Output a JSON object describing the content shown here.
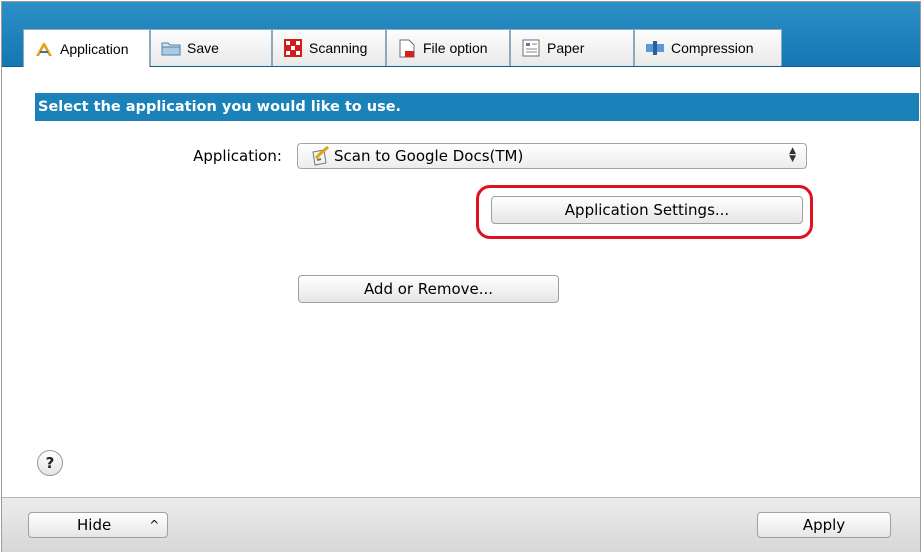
{
  "tabs": [
    {
      "label": "Application",
      "icon": "application-icon",
      "active": true
    },
    {
      "label": "Save",
      "icon": "save-icon"
    },
    {
      "label": "Scanning",
      "icon": "scanning-icon"
    },
    {
      "label": "File option",
      "icon": "file-option-icon"
    },
    {
      "label": "Paper",
      "icon": "paper-icon"
    },
    {
      "label": "Compression",
      "icon": "compression-icon"
    }
  ],
  "banner": "Select the application you would like to use.",
  "application": {
    "label": "Application:",
    "selected": "Scan to Google Docs(TM)",
    "icon": "google-docs-scan-icon"
  },
  "buttons": {
    "application_settings": "Application Settings...",
    "add_or_remove": "Add or Remove...",
    "hide": "Hide",
    "apply": "Apply"
  },
  "help": "?",
  "colors": {
    "accent": "#1a82b8",
    "highlight": "#e0101e"
  }
}
